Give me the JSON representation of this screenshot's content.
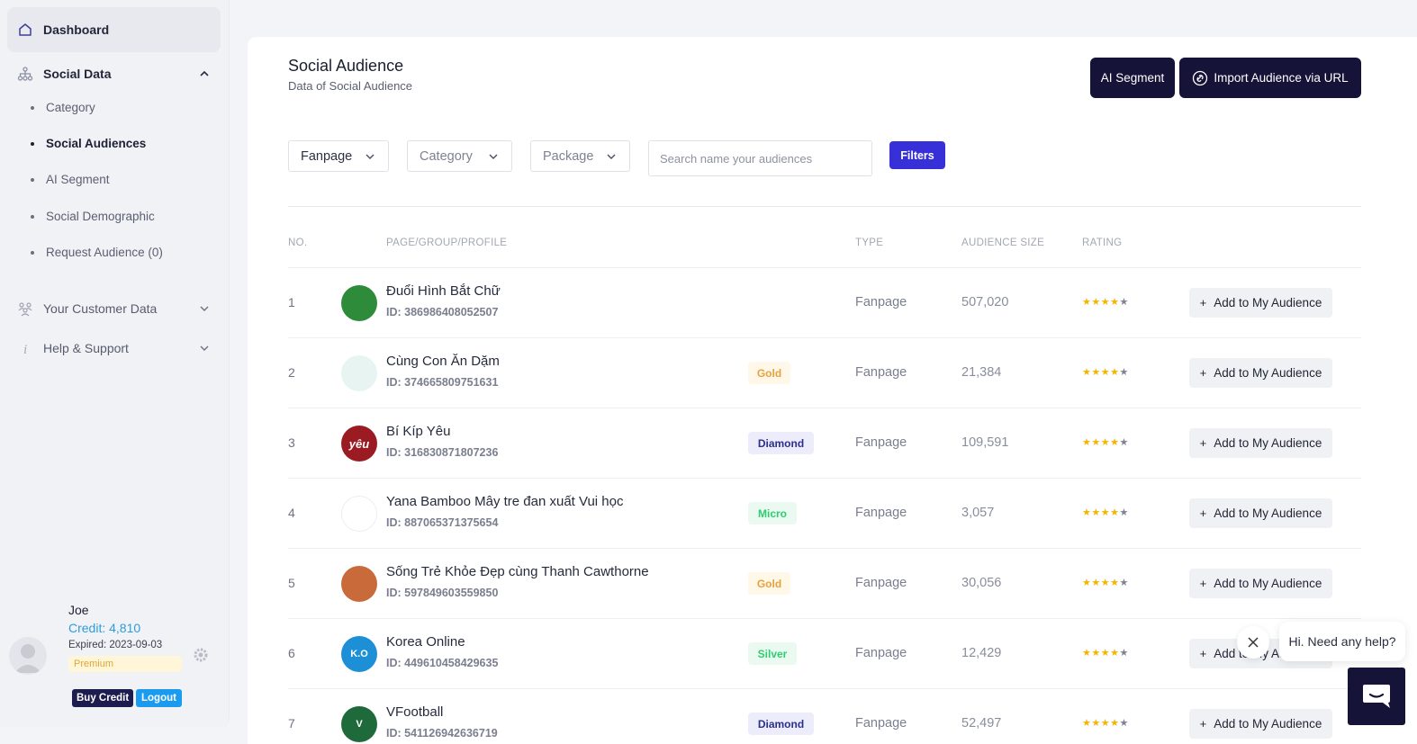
{
  "sidebar": {
    "dashboard": "Dashboard",
    "social_data": "Social Data",
    "sub_items": [
      "Category",
      "Social Audiences",
      "AI Segment",
      "Social Demographic",
      "Request Audience (0)"
    ],
    "customer_data": "Your Customer Data",
    "help": "Help & Support"
  },
  "user": {
    "name": "Joe",
    "credit": "Credit: 4,810",
    "expired": "Expired: 2023-09-03",
    "plan": "Premium",
    "buy_credit": "Buy Credit",
    "logout": "Logout"
  },
  "header": {
    "title": "Social Audience",
    "subtitle": "Data of Social Audience",
    "ai_segment": "AI Segment",
    "import": "Import Audience via URL"
  },
  "filters": {
    "fanpage": "Fanpage",
    "category": "Category",
    "package": "Package",
    "search_placeholder": "Search name your audiences",
    "filters_button": "Filters"
  },
  "table": {
    "headers": {
      "no": "NO.",
      "page": "PAGE/GROUP/PROFILE",
      "type": "TYPE",
      "size": "AUDIENCE SIZE",
      "rating": "RATING"
    },
    "add_label": "Add to My Audience",
    "rows": [
      {
        "no": "1",
        "name": "Đuổi Hình Bắt Chữ",
        "id": "ID: 386986408052507",
        "badge": "",
        "type": "Fanpage",
        "size": "507,020",
        "rating": 4
      },
      {
        "no": "2",
        "name": "Cùng Con Ăn Dặm",
        "id": "ID: 374665809751631",
        "badge": "Gold",
        "type": "Fanpage",
        "size": "21,384",
        "rating": 4
      },
      {
        "no": "3",
        "name": "Bí Kíp Yêu",
        "id": "ID: 316830871807236",
        "badge": "Diamond",
        "type": "Fanpage",
        "size": "109,591",
        "rating": 4
      },
      {
        "no": "4",
        "name": "Yana Bamboo Mây tre đan xuất Vui học",
        "id": "ID: 887065371375654",
        "badge": "Micro",
        "type": "Fanpage",
        "size": "3,057",
        "rating": 4
      },
      {
        "no": "5",
        "name": "Sống Trẻ Khỏe Đẹp cùng Thanh Cawthorne",
        "id": "ID: 597849603559850",
        "badge": "Gold",
        "type": "Fanpage",
        "size": "30,056",
        "rating": 4
      },
      {
        "no": "6",
        "name": "Korea Online",
        "id": "ID: 449610458429635",
        "badge": "Silver",
        "type": "Fanpage",
        "size": "12,429",
        "rating": 4
      },
      {
        "no": "7",
        "name": "VFootball",
        "id": "ID: 541126942636719",
        "badge": "Diamond",
        "type": "Fanpage",
        "size": "52,497",
        "rating": 4
      }
    ],
    "logos": [
      {
        "text": "",
        "bg": "#2e8b3a"
      },
      {
        "text": "",
        "bg": "#e8f4f2"
      },
      {
        "text": "yêu",
        "bg": "#9b1b22"
      },
      {
        "text": "",
        "bg": "#ffffff"
      },
      {
        "text": "",
        "bg": "#c86a3a"
      },
      {
        "text": "K.O",
        "bg": "#1c8fd6"
      },
      {
        "text": "V",
        "bg": "#1f6a3a"
      }
    ]
  },
  "chat": {
    "prompt": "Hi. Need any help?"
  },
  "colors": {
    "accent": "#3730d8",
    "dark": "#151337",
    "credit": "#2d9cdb",
    "star": "#f4b400"
  }
}
